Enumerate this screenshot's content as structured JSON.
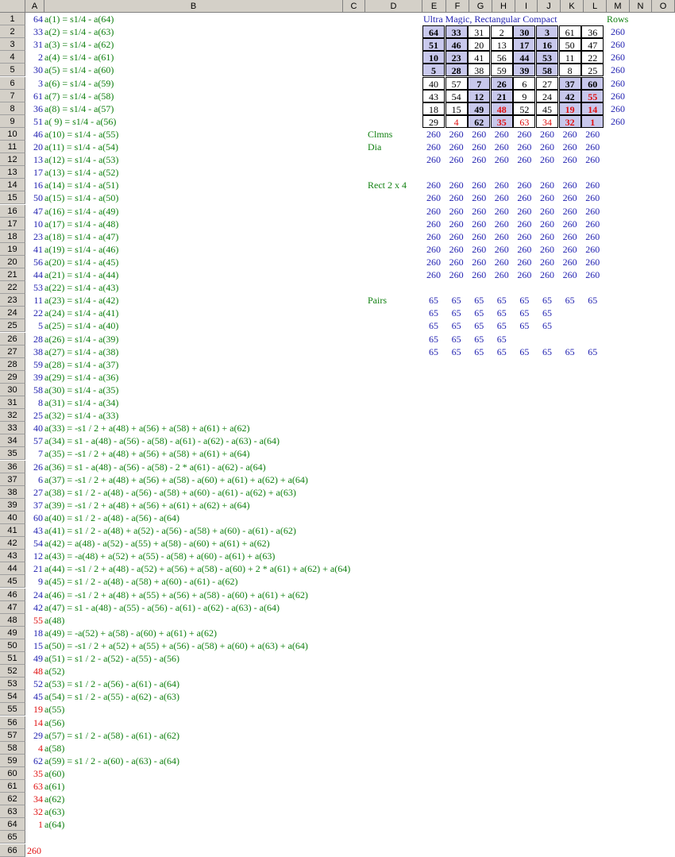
{
  "columns": [
    "A",
    "B",
    "C",
    "D",
    "E",
    "F",
    "G",
    "H",
    "I",
    "J",
    "K",
    "L",
    "M",
    "N",
    "O"
  ],
  "title": "Ultra Magic, Rectangular Compact",
  "rows_label": "Rows",
  "labels": {
    "clmns": "Clmns",
    "dia": "Dia",
    "rect": "Rect 2 x 4",
    "pairs": "Pairs"
  },
  "colA": [
    {
      "v": "64",
      "f": "a(1) = s1/4 - a(64)"
    },
    {
      "v": "33",
      "f": "a(2) = s1/4 - a(63)"
    },
    {
      "v": "31",
      "f": "a(3) = s1/4 - a(62)"
    },
    {
      "v": "2",
      "f": "a(4) = s1/4 - a(61)"
    },
    {
      "v": "30",
      "f": "a(5) = s1/4 - a(60)"
    },
    {
      "v": "3",
      "f": "a(6) = s1/4 - a(59)"
    },
    {
      "v": "61",
      "f": "a(7) = s1/4 - a(58)"
    },
    {
      "v": "36",
      "f": "a(8) = s1/4 - a(57)"
    },
    {
      "v": "51",
      "f": "a( 9) = s1/4 - a(56)"
    },
    {
      "v": "46",
      "f": "a(10) = s1/4 - a(55)"
    },
    {
      "v": "20",
      "f": "a(11) = s1/4 - a(54)"
    },
    {
      "v": "13",
      "f": "a(12) = s1/4 - a(53)"
    },
    {
      "v": "17",
      "f": "a(13) = s1/4 - a(52)"
    },
    {
      "v": "16",
      "f": "a(14) = s1/4 - a(51)"
    },
    {
      "v": "50",
      "f": "a(15) = s1/4 - a(50)"
    },
    {
      "v": "47",
      "f": "a(16) = s1/4 - a(49)"
    },
    {
      "v": "10",
      "f": "a(17) = s1/4 - a(48)"
    },
    {
      "v": "23",
      "f": "a(18) = s1/4 - a(47)"
    },
    {
      "v": "41",
      "f": "a(19) = s1/4 - a(46)"
    },
    {
      "v": "56",
      "f": "a(20) = s1/4 - a(45)"
    },
    {
      "v": "44",
      "f": "a(21) = s1/4 - a(44)"
    },
    {
      "v": "53",
      "f": "a(22) = s1/4 - a(43)"
    },
    {
      "v": "11",
      "f": "a(23) = s1/4 - a(42)"
    },
    {
      "v": "22",
      "f": "a(24) = s1/4 - a(41)"
    },
    {
      "v": "5",
      "f": "a(25) = s1/4 - a(40)"
    },
    {
      "v": "28",
      "f": "a(26) = s1/4 - a(39)"
    },
    {
      "v": "38",
      "f": "a(27) = s1/4 - a(38)"
    },
    {
      "v": "59",
      "f": "a(28) = s1/4 - a(37)"
    },
    {
      "v": "39",
      "f": "a(29) = s1/4 - a(36)"
    },
    {
      "v": "58",
      "f": "a(30) = s1/4 - a(35)"
    },
    {
      "v": "8",
      "f": "a(31) = s1/4 - a(34)"
    },
    {
      "v": "25",
      "f": "a(32) = s1/4 - a(33)"
    },
    {
      "v": "40",
      "f": "a(33) = -s1 / 2 + a(48) + a(56) + a(58) + a(61) + a(62)"
    },
    {
      "v": "57",
      "f": "a(34) = s1 - a(48) - a(56) - a(58) - a(61) - a(62) - a(63) - a(64)"
    },
    {
      "v": "7",
      "f": "a(35) = -s1 / 2 + a(48) + a(56) + a(58) + a(61) + a(64)"
    },
    {
      "v": "26",
      "f": "a(36) = s1 - a(48) - a(56) - a(58) - 2 * a(61) - a(62) - a(64)"
    },
    {
      "v": "6",
      "f": "a(37) = -s1 / 2 + a(48) + a(56) + a(58) - a(60) + a(61) + a(62) + a(64)"
    },
    {
      "v": "27",
      "f": "a(38) = s1 / 2 - a(48) - a(56) - a(58) + a(60) - a(61) - a(62) + a(63)"
    },
    {
      "v": "37",
      "f": "a(39) = -s1 / 2 + a(48) + a(56) + a(61) + a(62) + a(64)"
    },
    {
      "v": "60",
      "f": "a(40) = s1 / 2 - a(48) - a(56) - a(64)"
    },
    {
      "v": "43",
      "f": "a(41) = s1 / 2 - a(48) + a(52) - a(56) - a(58) + a(60) - a(61) - a(62)"
    },
    {
      "v": "54",
      "f": "a(42) = a(48) - a(52) - a(55) + a(58) - a(60) + a(61) + a(62)"
    },
    {
      "v": "12",
      "f": "a(43) = -a(48) + a(52) + a(55) - a(58) + a(60) - a(61) + a(63)"
    },
    {
      "v": "21",
      "f": "a(44) = -s1 / 2 + a(48) - a(52) + a(56) + a(58) - a(60) + 2 * a(61) + a(62) + a(64)"
    },
    {
      "v": "9",
      "f": "a(45) = s1 / 2 - a(48) - a(58) + a(60) - a(61) - a(62)"
    },
    {
      "v": "24",
      "f": "a(46) = -s1 / 2 + a(48) + a(55) + a(56) + a(58) - a(60) + a(61) + a(62)"
    },
    {
      "v": "42",
      "f": "a(47) = s1 - a(48) - a(55) - a(56) - a(61) - a(62) - a(63) - a(64)"
    },
    {
      "v": "55",
      "f": "a(48)",
      "red": true
    },
    {
      "v": "18",
      "f": "a(49) = -a(52) + a(58) - a(60) + a(61) + a(62)"
    },
    {
      "v": "15",
      "f": "a(50) = -s1 / 2 + a(52) + a(55) + a(56) - a(58) + a(60) + a(63) + a(64)"
    },
    {
      "v": "49",
      "f": "a(51) = s1 / 2 - a(52) - a(55) - a(56)"
    },
    {
      "v": "48",
      "f": "a(52)",
      "red": true
    },
    {
      "v": "52",
      "f": "a(53) = s1 / 2 - a(56) - a(61) - a(64)"
    },
    {
      "v": "45",
      "f": "a(54) = s1 / 2 - a(55) - a(62) - a(63)"
    },
    {
      "v": "19",
      "f": "a(55)",
      "red": true
    },
    {
      "v": "14",
      "f": "a(56)",
      "red": true
    },
    {
      "v": "29",
      "f": "a(57) = s1 / 2 - a(58) - a(61) - a(62)"
    },
    {
      "v": "4",
      "f": "a(58)",
      "red": true
    },
    {
      "v": "62",
      "f": "a(59) = s1 / 2 - a(60) - a(63) - a(64)"
    },
    {
      "v": "35",
      "f": "a(60)",
      "red": true
    },
    {
      "v": "63",
      "f": "a(61)",
      "red": true
    },
    {
      "v": "34",
      "f": "a(62)",
      "red": true
    },
    {
      "v": "32",
      "f": "a(63)",
      "red": true
    },
    {
      "v": "1",
      "f": "a(64)",
      "red": true
    },
    {
      "v": "",
      "f": ""
    },
    {
      "v": "260",
      "f": "",
      "red": true
    }
  ],
  "square": [
    [
      "64",
      "33",
      "31",
      "2",
      "30",
      "3",
      "61",
      "36"
    ],
    [
      "51",
      "46",
      "20",
      "13",
      "17",
      "16",
      "50",
      "47"
    ],
    [
      "10",
      "23",
      "41",
      "56",
      "44",
      "53",
      "11",
      "22"
    ],
    [
      "5",
      "28",
      "38",
      "59",
      "39",
      "58",
      "8",
      "25"
    ],
    [
      "40",
      "57",
      "7",
      "26",
      "6",
      "27",
      "37",
      "60"
    ],
    [
      "43",
      "54",
      "12",
      "21",
      "9",
      "24",
      "42",
      "55"
    ],
    [
      "18",
      "15",
      "49",
      "48",
      "52",
      "45",
      "19",
      "14"
    ],
    [
      "29",
      "4",
      "62",
      "35",
      "63",
      "34",
      "32",
      "1"
    ]
  ],
  "shaded": [
    [
      1,
      1,
      0,
      0,
      1,
      1,
      0,
      0
    ],
    [
      1,
      1,
      0,
      0,
      1,
      1,
      0,
      0
    ],
    [
      1,
      1,
      0,
      0,
      1,
      1,
      0,
      0
    ],
    [
      1,
      1,
      0,
      0,
      1,
      1,
      0,
      0
    ],
    [
      0,
      0,
      1,
      1,
      0,
      0,
      1,
      1
    ],
    [
      0,
      0,
      1,
      1,
      0,
      0,
      1,
      1
    ],
    [
      0,
      0,
      1,
      1,
      0,
      0,
      1,
      1
    ],
    [
      0,
      0,
      1,
      1,
      0,
      0,
      1,
      1
    ]
  ],
  "red_cells": [
    [
      5,
      7
    ],
    [
      6,
      3
    ],
    [
      6,
      6
    ],
    [
      6,
      7
    ],
    [
      7,
      1
    ],
    [
      7,
      3
    ],
    [
      7,
      4
    ],
    [
      7,
      5
    ],
    [
      7,
      6
    ],
    [
      7,
      7
    ]
  ],
  "row_sums": [
    "260",
    "260",
    "260",
    "260",
    "260",
    "260",
    "260",
    "260"
  ],
  "clmns": [
    "260",
    "260",
    "260",
    "260",
    "260",
    "260",
    "260",
    "260"
  ],
  "dia": [
    "260",
    "260",
    "260",
    "260",
    "260",
    "260",
    "260",
    "260"
  ],
  "dia2": [
    "260",
    "260",
    "260",
    "260",
    "260",
    "260",
    "260",
    "260"
  ],
  "rect": [
    [
      "260",
      "260",
      "260",
      "260",
      "260",
      "260",
      "260",
      "260"
    ],
    [
      "260",
      "260",
      "260",
      "260",
      "260",
      "260",
      "260",
      "260"
    ],
    [
      "260",
      "260",
      "260",
      "260",
      "260",
      "260",
      "260",
      "260"
    ],
    [
      "260",
      "260",
      "260",
      "260",
      "260",
      "260",
      "260",
      "260"
    ],
    [
      "260",
      "260",
      "260",
      "260",
      "260",
      "260",
      "260",
      "260"
    ],
    [
      "260",
      "260",
      "260",
      "260",
      "260",
      "260",
      "260",
      "260"
    ],
    [
      "260",
      "260",
      "260",
      "260",
      "260",
      "260",
      "260",
      "260"
    ],
    [
      "260",
      "260",
      "260",
      "260",
      "260",
      "260",
      "260",
      "260"
    ]
  ],
  "pairs": [
    [
      "65",
      "65",
      "65",
      "65",
      "65",
      "65",
      "65",
      "65"
    ],
    [
      "65",
      "65",
      "65",
      "65",
      "65",
      "65"
    ],
    [
      "65",
      "65",
      "65",
      "65",
      "65",
      "65"
    ],
    [
      "65",
      "65",
      "65",
      "65"
    ],
    [
      "65",
      "65",
      "65",
      "65",
      "65",
      "65",
      "65",
      "65"
    ]
  ],
  "colors": {
    "header_bg": "#d4d0c8",
    "shade": "#c8c8ec",
    "blue": "#1f1fb0",
    "green": "#108010",
    "red": "#e01010"
  }
}
